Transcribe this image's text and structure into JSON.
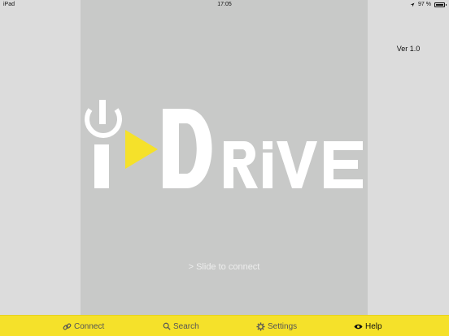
{
  "status_bar": {
    "device": "iPad",
    "time": "17:05",
    "battery": "97 %",
    "battery_level": 0.97
  },
  "version": "Ver 1.0",
  "logo": {
    "letters": "DRiVE",
    "accent_color": "#f5e12a"
  },
  "slide_label": "> Slide to connect",
  "tabs": [
    {
      "label": "Connect",
      "icon": "link-icon",
      "active": false
    },
    {
      "label": "Search",
      "icon": "search-icon",
      "active": false
    },
    {
      "label": "Settings",
      "icon": "gear-icon",
      "active": false
    },
    {
      "label": "Help",
      "icon": "eye-icon",
      "active": true
    }
  ],
  "colors": {
    "tab_bar": "#f5e12a",
    "panel": "#c8c9c8",
    "side": "#dcdcdc"
  }
}
